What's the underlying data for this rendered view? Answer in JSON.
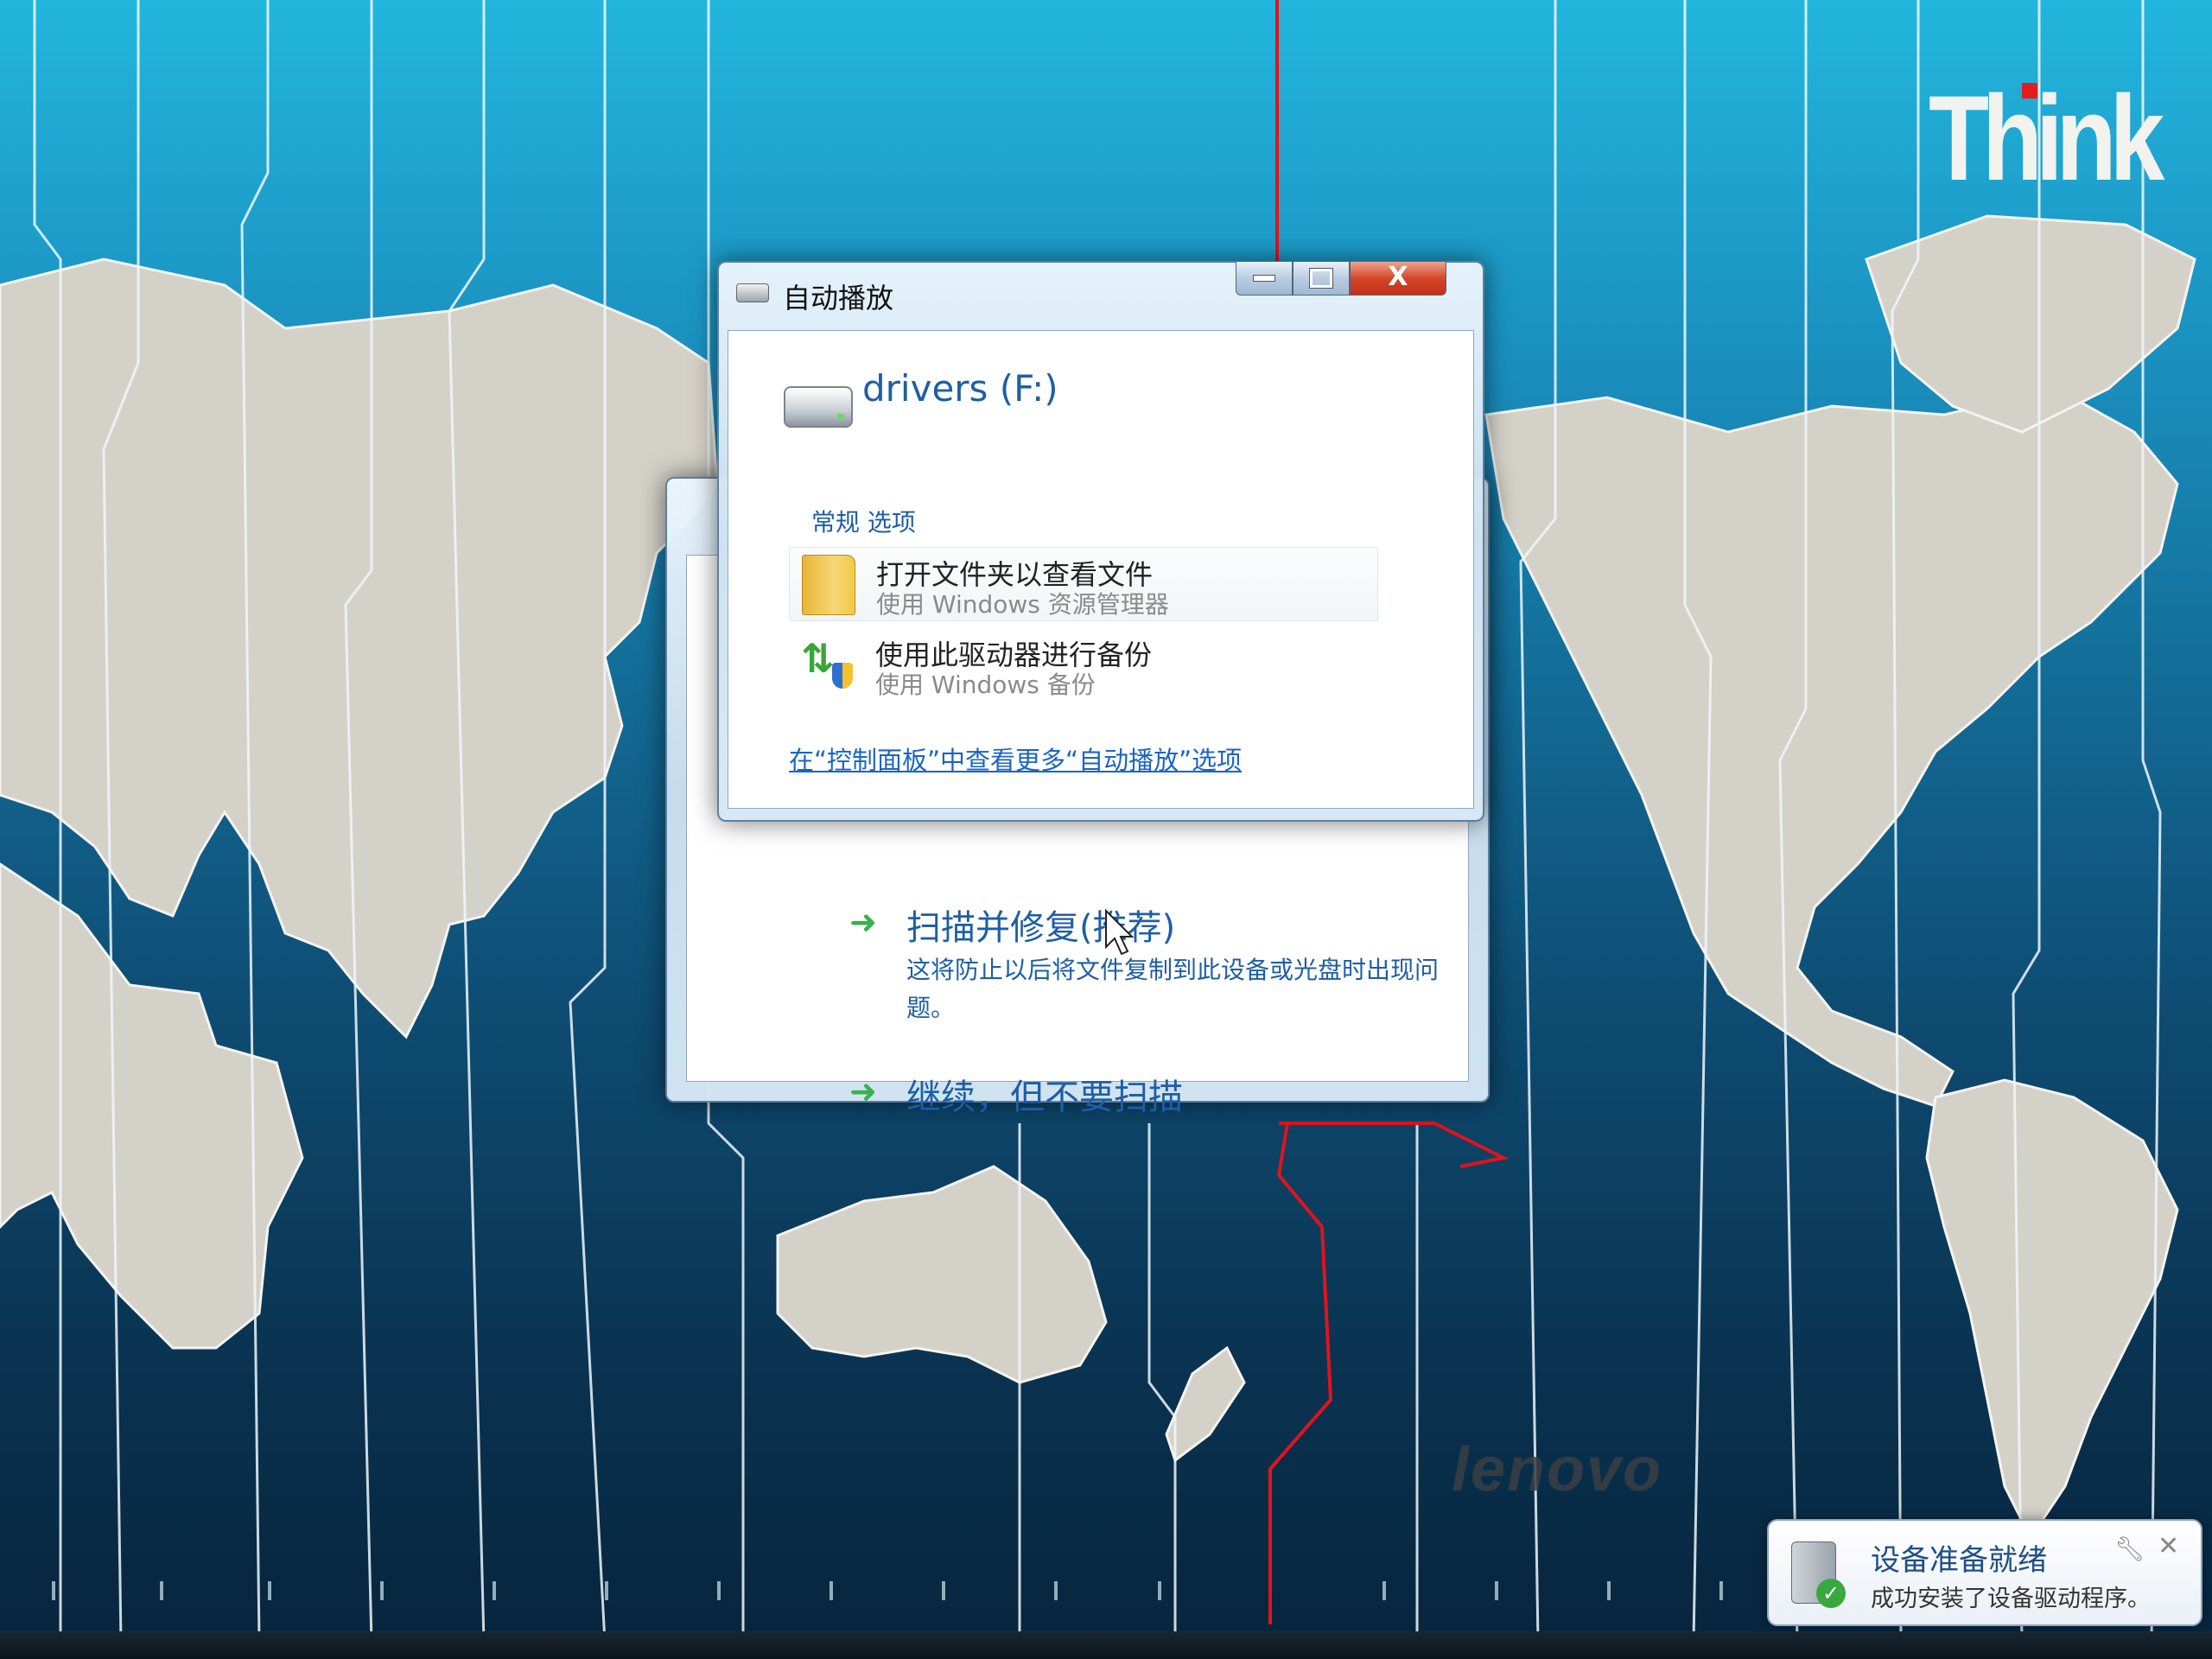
{
  "desktop": {
    "brand_top": "Think",
    "brand_bottom": "lenovo"
  },
  "autoplay_window": {
    "title": "自动播放",
    "drive_label": "drivers (F:)",
    "section_label": "常规 选项",
    "options": [
      {
        "main": "打开文件夹以查看文件",
        "sub": "使用 Windows 资源管理器",
        "icon": "folder-icon"
      },
      {
        "main": "使用此驱动器进行备份",
        "sub": "使用 Windows 备份",
        "icon": "backup-icon"
      }
    ],
    "more_link": "在“控制面板”中查看更多“自动播放”选项",
    "close_glyph": "X"
  },
  "scan_window": {
    "option1_title": "扫描并修复(推荐)",
    "option1_desc": "这将防止以后将文件复制到此设备或光盘时出现问题。",
    "option2_title": "继续，但不要扫描"
  },
  "notification": {
    "title": "设备准备就绪",
    "body": "成功安装了设备驱动程序。"
  },
  "colors": {
    "link_blue": "#1e5ea6",
    "arrow_green": "#37b24d",
    "close_red": "#c42f15",
    "dateline_red": "#e0141c"
  }
}
